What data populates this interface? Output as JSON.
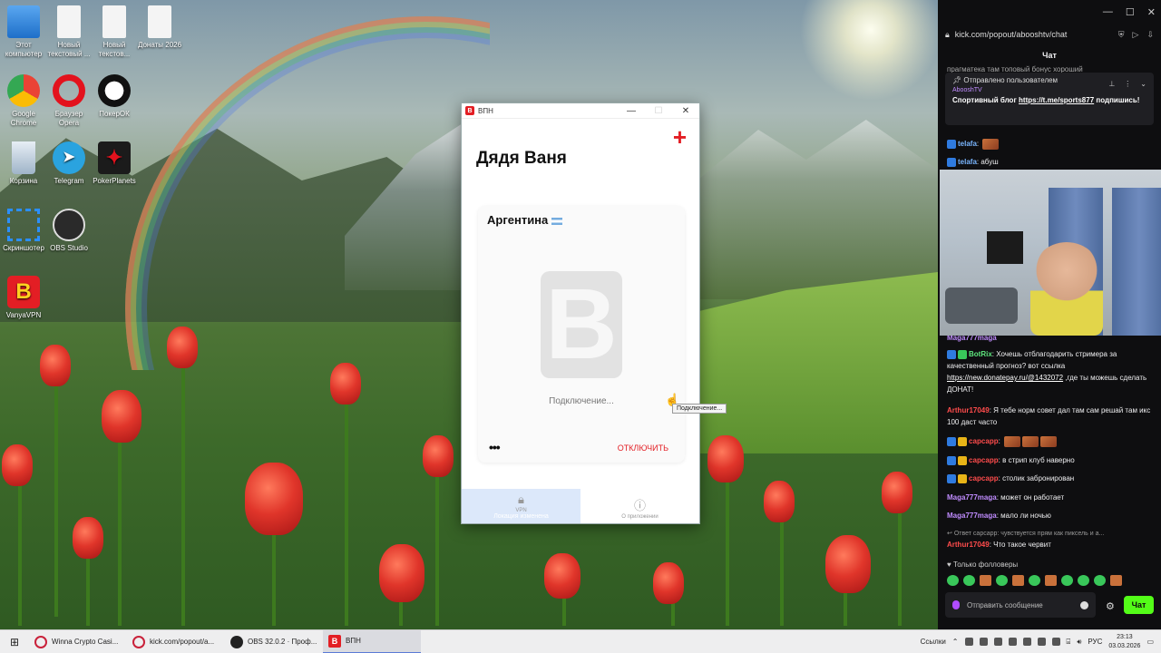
{
  "desktop": {
    "icons": [
      {
        "label": "Этот компьютер",
        "icon": "computer-icon"
      },
      {
        "label": "Новый текстовый ...",
        "icon": "text-file-icon"
      },
      {
        "label": "Новый текстов...",
        "icon": "text-file-icon"
      },
      {
        "label": "Донаты 2026",
        "icon": "text-file-icon"
      },
      {
        "label": "Google Chrome",
        "icon": "chrome-icon"
      },
      {
        "label": "Браузер Opera",
        "icon": "opera-icon"
      },
      {
        "label": "ПокерОК",
        "icon": "pokerok-icon"
      },
      {
        "label": "Корзина",
        "icon": "recycle-bin-icon"
      },
      {
        "label": "Telegram",
        "icon": "telegram-icon"
      },
      {
        "label": "PokerPlanets",
        "icon": "pokerplanets-icon"
      },
      {
        "label": "Скриншотер",
        "icon": "screenshot-icon"
      },
      {
        "label": "OBS Studio",
        "icon": "obs-icon"
      },
      {
        "label": "VanyaVPN",
        "icon": "vanyavpn-icon"
      }
    ]
  },
  "vpn_window": {
    "title": "ВПН",
    "heading": "Дядя Ваня",
    "country": "Аргентина",
    "logo_letter": "B",
    "status": "Подключение...",
    "more": "•••",
    "disconnect_label": "ОТКЛЮЧИТЬ",
    "tabs": [
      {
        "label": "VPN",
        "sub": "Локация изменена"
      },
      {
        "label": "О приложении"
      }
    ],
    "tooltip": "Подключение..."
  },
  "chat": {
    "url": "kick.com/popout/abooshtv/chat",
    "header": "Чат",
    "top_cut_message": "прагматека там топовый бонус хороший",
    "pinned": {
      "by_label": "Отправлено пользователем",
      "author": "AbooshTV",
      "text": "Спортивный блог",
      "link": "https://t.me/sports877",
      "text_end": "подпишись!"
    },
    "messages": [
      {
        "user": "telafa",
        "text": ""
      },
      {
        "user": "telafa",
        "text": "абуш"
      },
      {
        "user": "Maga777maga",
        "text": ""
      },
      {
        "user": "BotRix",
        "text": "Хочешь отблагодарить стримера за качественный прогноз? вот ссылка",
        "link": "https://new.donatepay.ru/@1432072",
        "text_end": ",где ты можешь сделать ДОНАТ!"
      },
      {
        "user": "Arthur17049",
        "text": "Я тебе норм совет дал там сам решай там икс 100 даст часто"
      },
      {
        "user": "сарсарр",
        "text": ""
      },
      {
        "user": "сарсарр",
        "text": "в стрип клуб наверно"
      },
      {
        "user": "сарсарр",
        "text": "столик забронирован"
      },
      {
        "user": "Maga777maga",
        "text": "может он работает"
      },
      {
        "user": "Maga777maga",
        "text": "мало ли ночью"
      },
      {
        "user": "",
        "text": "Ответ сарсарр: чувствуется прям как пиксель и а..."
      },
      {
        "user": "Arthur17049",
        "text": "Что такое червит"
      }
    ],
    "followers_only": "Только фолловеры",
    "input_placeholder": "Отправить сообщение",
    "send_label": "Чат"
  },
  "taskbar": {
    "tasks": [
      {
        "label": "Winna Crypto Casi...",
        "icon": "opera-icon"
      },
      {
        "label": "kick.com/popout/a...",
        "icon": "opera-icon"
      },
      {
        "label": "OBS 32.0.2 · Проф...",
        "icon": "obs-icon"
      },
      {
        "label": "ВПН",
        "icon": "vanyavpn-icon"
      }
    ],
    "links_label": "Ссылки",
    "lang": "РУС",
    "time": "23:13",
    "date": "03.03.2026"
  },
  "colors": {
    "vpn_red": "#e31e24",
    "kick_green": "#53fc18",
    "chat_bg": "#0e0e10"
  }
}
